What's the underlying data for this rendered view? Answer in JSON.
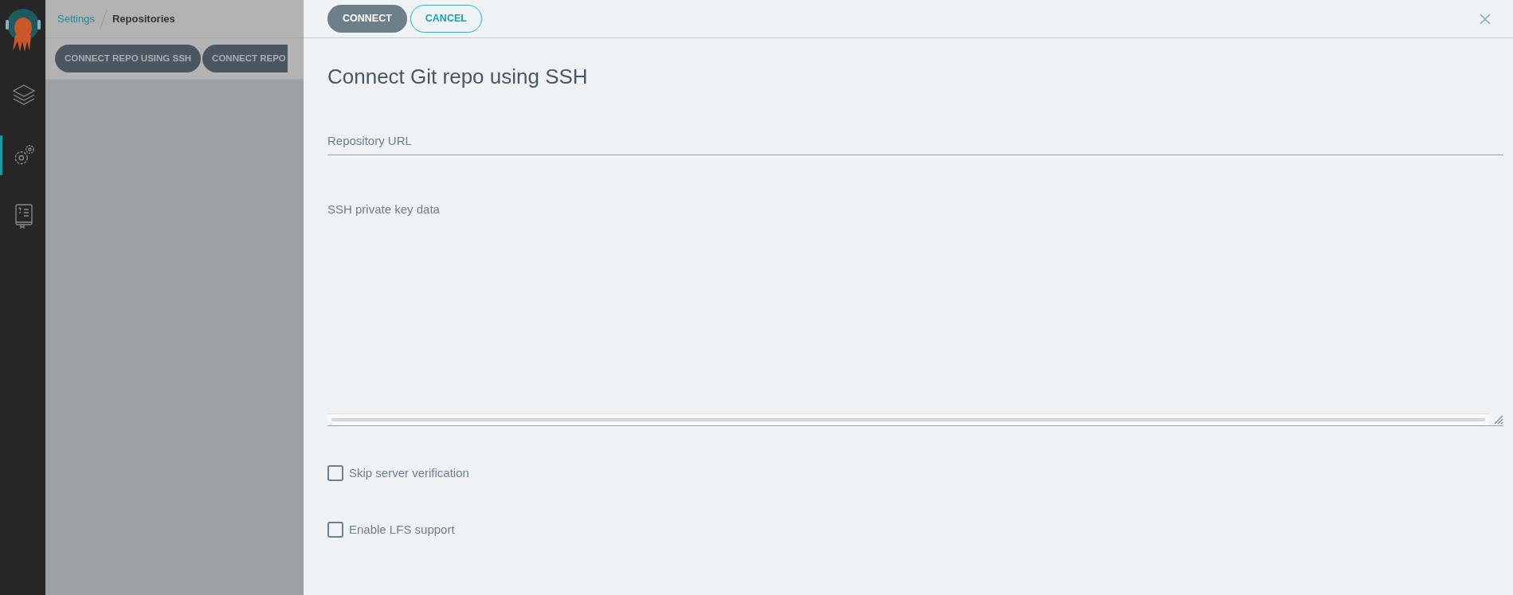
{
  "sidebar": {
    "items": [
      {
        "kind": "layers",
        "selected": false
      },
      {
        "kind": "settings",
        "selected": true
      },
      {
        "kind": "docs",
        "selected": false
      }
    ]
  },
  "breadcrumb": [
    {
      "label": "Settings",
      "kind": "link"
    },
    {
      "label": "Repositories",
      "kind": "current"
    }
  ],
  "toolbar": {
    "buttons": [
      "CONNECT REPO USING SSH",
      "CONNECT REPO"
    ]
  },
  "panel": {
    "actions": [
      {
        "label": "CONNECT",
        "kind": "primary"
      },
      {
        "label": "CANCEL",
        "kind": "outline"
      }
    ],
    "title": "Connect Git repo using SSH",
    "fields": [
      {
        "label": "Repository URL",
        "kind": "input"
      },
      {
        "label": "SSH private key data",
        "kind": "textarea"
      }
    ],
    "checkboxes": [
      {
        "label": "Skip server verification",
        "checked": false
      },
      {
        "label": "Enable LFS support",
        "checked": false
      }
    ]
  }
}
